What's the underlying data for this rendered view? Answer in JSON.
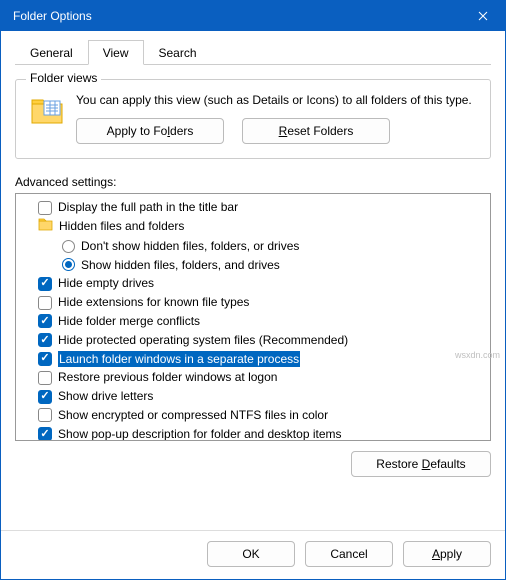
{
  "titlebar": {
    "title": "Folder Options"
  },
  "tabs": {
    "general": "General",
    "view": "View",
    "search": "Search"
  },
  "folder_views": {
    "group_label": "Folder views",
    "description": "You can apply this view (such as Details or Icons) to all folders of this type.",
    "apply_btn_prefix": "Apply to Fo",
    "apply_btn_u": "l",
    "apply_btn_suffix": "ders",
    "reset_btn_u": "R",
    "reset_btn_suffix": "eset Folders"
  },
  "advanced": {
    "label": "Advanced settings:",
    "items": [
      {
        "type": "check",
        "checked": false,
        "label": "Display the full path in the title bar"
      },
      {
        "type": "group",
        "label": "Hidden files and folders"
      },
      {
        "type": "radio",
        "checked": false,
        "indent": true,
        "label": "Don't show hidden files, folders, or drives"
      },
      {
        "type": "radio",
        "checked": true,
        "indent": true,
        "label": "Show hidden files, folders, and drives"
      },
      {
        "type": "check",
        "checked": true,
        "label": "Hide empty drives"
      },
      {
        "type": "check",
        "checked": false,
        "label": "Hide extensions for known file types"
      },
      {
        "type": "check",
        "checked": true,
        "label": "Hide folder merge conflicts"
      },
      {
        "type": "check",
        "checked": true,
        "label": "Hide protected operating system files (Recommended)"
      },
      {
        "type": "check",
        "checked": true,
        "selected": true,
        "label": "Launch folder windows in a separate process"
      },
      {
        "type": "check",
        "checked": false,
        "label": "Restore previous folder windows at logon"
      },
      {
        "type": "check",
        "checked": true,
        "label": "Show drive letters"
      },
      {
        "type": "check",
        "checked": false,
        "label": "Show encrypted or compressed NTFS files in color"
      },
      {
        "type": "check",
        "checked": true,
        "label": "Show pop-up description for folder and desktop items"
      }
    ],
    "restore_prefix": "Restore ",
    "restore_u": "D",
    "restore_suffix": "efaults"
  },
  "footer": {
    "ok": "OK",
    "cancel": "Cancel",
    "apply_u": "A",
    "apply_suffix": "pply"
  },
  "watermark": "wsxdn.com"
}
